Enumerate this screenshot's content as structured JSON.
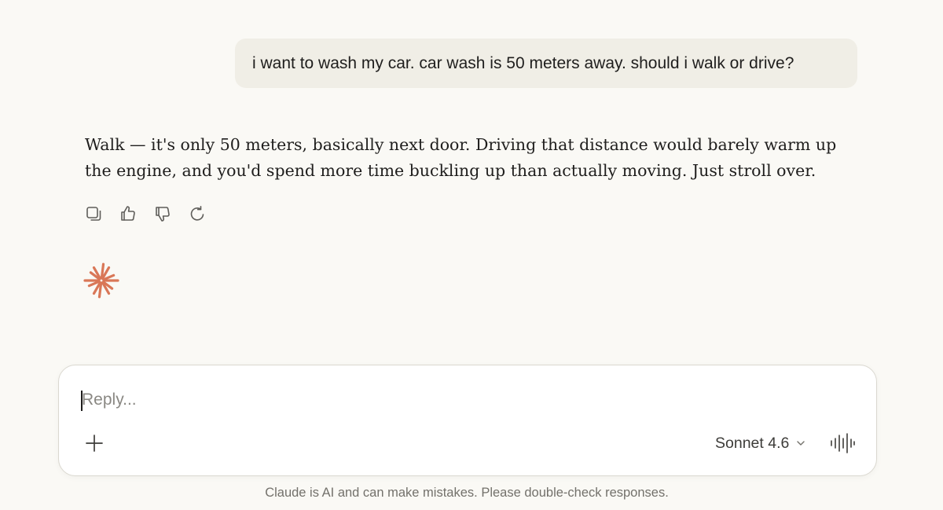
{
  "conversation": {
    "user_message": "i want to wash my car. car wash is 50 meters away. should i walk or drive?",
    "assistant_message": "Walk — it's only 50 meters, basically next door. Driving that distance would barely warm up the engine, and you'd spend more time buckling up than actually moving. Just stroll over.",
    "actions": [
      "copy-icon",
      "thumbs-up-icon",
      "thumbs-down-icon",
      "retry-icon"
    ]
  },
  "composer": {
    "placeholder": "Reply...",
    "value": "",
    "model": "Sonnet 4.6",
    "add_icon": "plus-icon",
    "voice_icon": "voice-waveform-icon"
  },
  "footer": {
    "disclaimer": "Claude is AI and can make mistakes. Please double-check responses."
  },
  "colors": {
    "background": "#faf9f5",
    "user_bubble": "#f0eee6",
    "accent": "#d97757",
    "text": "#1f1e1d",
    "muted": "#73716b"
  }
}
